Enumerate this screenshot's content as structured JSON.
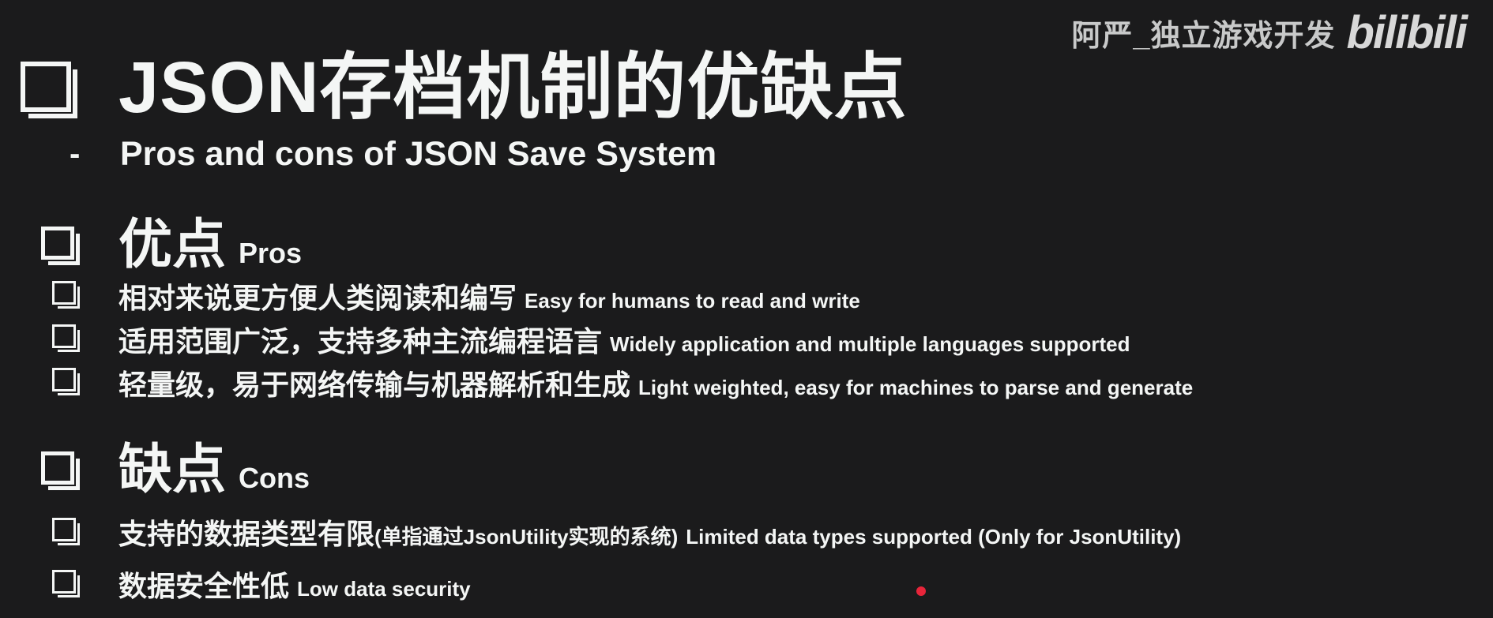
{
  "watermark": {
    "channel": "阿严_独立游戏开发",
    "logo": "bilibili"
  },
  "slide": {
    "title": "JSON存档机制的优缺点",
    "subtitle_dash": "-",
    "subtitle": "Pros and cons of JSON Save System",
    "pros": {
      "heading_zh": "优点",
      "heading_en": "Pros",
      "items": [
        {
          "zh": "相对来说更方便人类阅读和编写",
          "en": "Easy for humans to read and write"
        },
        {
          "zh": "适用范围广泛，支持多种主流编程语言",
          "en": "Widely application and multiple languages supported"
        },
        {
          "zh": "轻量级，易于网络传输与机器解析和生成",
          "en": "Light weighted, easy for machines to parse and generate"
        }
      ]
    },
    "cons": {
      "heading_zh": "缺点",
      "heading_en": "Cons",
      "items": [
        {
          "zh": "支持的数据类型有限",
          "mid": "(单指通过JsonUtility实现的系统)",
          "en": "Limited data types supported (Only for JsonUtility)"
        },
        {
          "zh": "数据安全性低",
          "en": "Low data security"
        }
      ]
    }
  },
  "colors": {
    "background": "#1b1b1c",
    "text": "#f4f6f5",
    "cursor": "#e8253a"
  }
}
